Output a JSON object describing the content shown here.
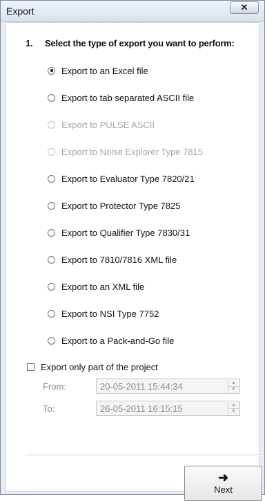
{
  "window": {
    "title": "Export",
    "close_glyph": "✕"
  },
  "step": {
    "number": "1.",
    "text": "Select the type of export you want to perform:"
  },
  "options": [
    {
      "label": "Export to an Excel file",
      "checked": true,
      "enabled": true
    },
    {
      "label": "Export to tab separated ASCII file",
      "checked": false,
      "enabled": true
    },
    {
      "label": "Export to PULSE ASCII",
      "checked": false,
      "enabled": false
    },
    {
      "label": "Export to Noise Explorer Type 7815",
      "checked": false,
      "enabled": false
    },
    {
      "label": "Export to Evaluator Type 7820/21",
      "checked": false,
      "enabled": true
    },
    {
      "label": "Export to Protector Type 7825",
      "checked": false,
      "enabled": true
    },
    {
      "label": "Export to Qualifier Type 7830/31",
      "checked": false,
      "enabled": true
    },
    {
      "label": "Export to 7810/7816 XML file",
      "checked": false,
      "enabled": true
    },
    {
      "label": "Export to an XML file",
      "checked": false,
      "enabled": true
    },
    {
      "label": "Export to NSI Type 7752",
      "checked": false,
      "enabled": true
    },
    {
      "label": "Export to a Pack-and-Go file",
      "checked": false,
      "enabled": true
    }
  ],
  "partial_export": {
    "label": "Export only part of the project",
    "checked": false
  },
  "range": {
    "from_label": "From:",
    "from_value": "20-05-2011 15:44:34",
    "to_label": "To:",
    "to_value": "26-05-2011 16:15:15"
  },
  "next_button": {
    "arrow": "➜",
    "label": "Next"
  }
}
